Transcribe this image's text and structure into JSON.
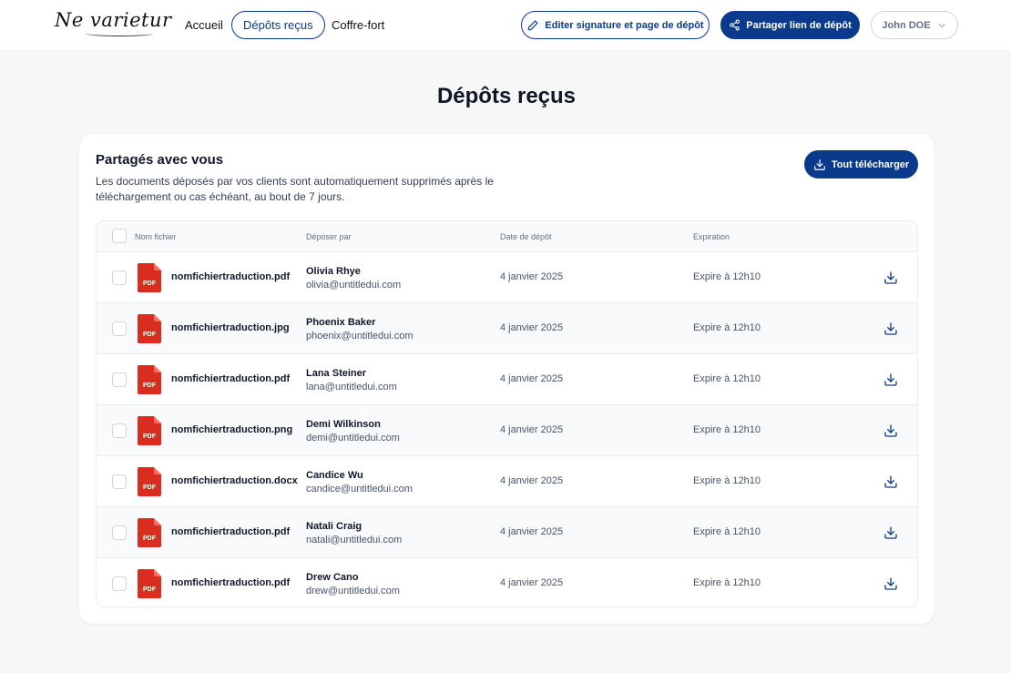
{
  "header": {
    "logo_text": "Ne varietur",
    "nav": [
      {
        "label": "Accueil"
      },
      {
        "label": "Dépôts reçus"
      },
      {
        "label": "Coffre-fort"
      }
    ],
    "edit_button_label": "Editer signature et page de dépôt",
    "share_button_label": "Partager lien de dépôt",
    "user_label": "John DOE",
    "accent_color": "#0b3a8c"
  },
  "page": {
    "title": "Dépôts reçus"
  },
  "card": {
    "title": "Partagés avec vous",
    "description": "Les documents déposés par vos clients sont automatiquement supprimés après le téléchargement ou cas échéant, au bout de 7 jours.",
    "download_all_label": "Tout télécharger"
  },
  "table": {
    "columns": {
      "file": "Nom fichier",
      "by": "Déposer par",
      "date": "Date de dépôt",
      "expiration": "Expiration"
    },
    "file_icon_label": "PDF",
    "rows": [
      {
        "file": "nomfichiertraduction.pdf",
        "name": "Olivia Rhye",
        "email": "olivia@untitledui.com",
        "date": "4 janvier 2025",
        "expiration": "Expire à 12h10"
      },
      {
        "file": "nomfichiertraduction.jpg",
        "name": "Phoenix Baker",
        "email": "phoenix@untitledui.com",
        "date": "4 janvier 2025",
        "expiration": "Expire à 12h10"
      },
      {
        "file": "nomfichiertraduction.pdf",
        "name": "Lana Steiner",
        "email": "lana@untitledui.com",
        "date": "4 janvier 2025",
        "expiration": "Expire à 12h10"
      },
      {
        "file": "nomfichiertraduction.png",
        "name": "Demi Wilkinson",
        "email": "demi@untitledui.com",
        "date": "4 janvier 2025",
        "expiration": "Expire à 12h10"
      },
      {
        "file": "nomfichiertraduction.docx",
        "name": "Candice Wu",
        "email": "candice@untitledui.com",
        "date": "4 janvier 2025",
        "expiration": "Expire à 12h10"
      },
      {
        "file": "nomfichiertraduction.pdf",
        "name": "Natali Craig",
        "email": "natali@untitledui.com",
        "date": "4 janvier 2025",
        "expiration": "Expire à 12h10"
      },
      {
        "file": "nomfichiertraduction.pdf",
        "name": "Drew Cano",
        "email": "drew@untitledui.com",
        "date": "4 janvier 2025",
        "expiration": "Expire à 12h10"
      }
    ]
  }
}
